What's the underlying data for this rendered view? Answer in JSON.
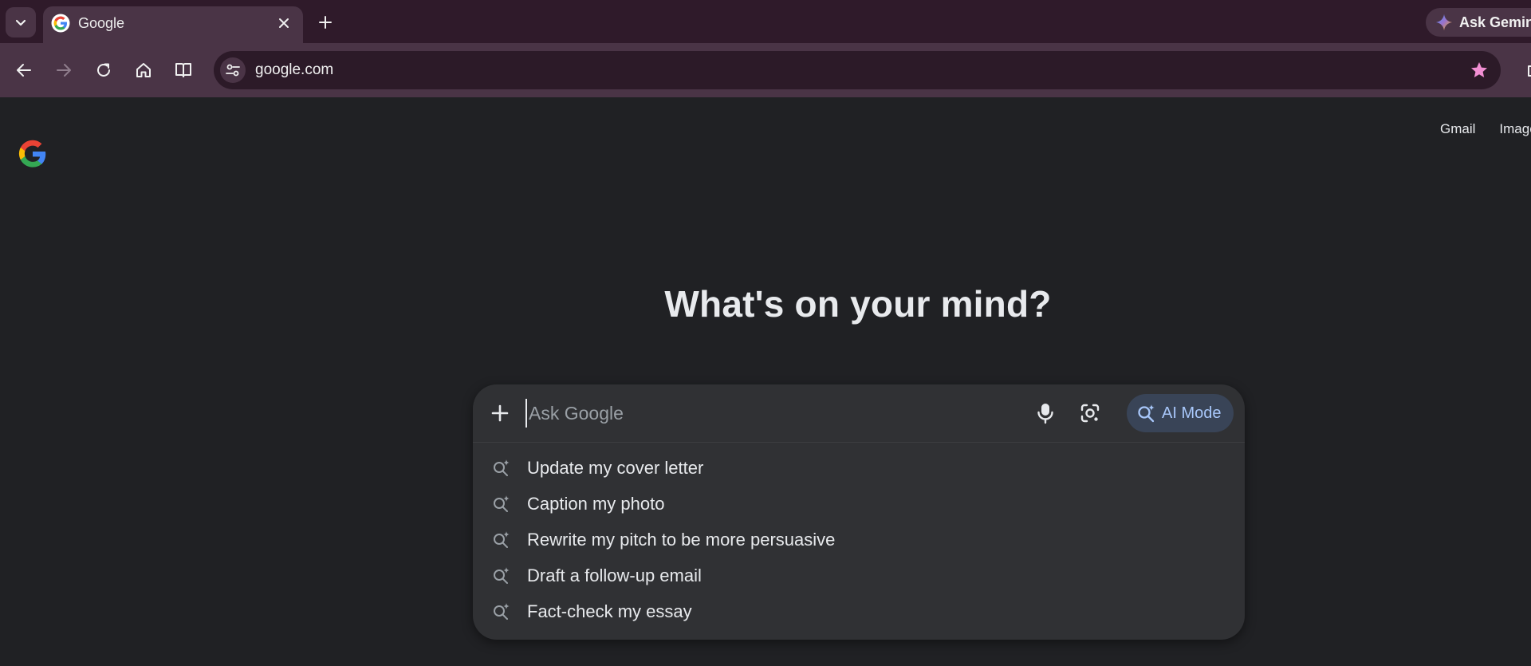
{
  "browser": {
    "tab": {
      "title": "Google"
    },
    "gemini_button": {
      "label": "Ask Gemini"
    },
    "omnibox": {
      "url": "google.com"
    }
  },
  "page": {
    "top_links": [
      "Gmail",
      "Images"
    ],
    "headline": "What's on your mind?",
    "search": {
      "placeholder": "Ask Google",
      "ai_mode_label": "AI Mode"
    },
    "suggestions": [
      "Update my cover letter",
      "Caption my photo",
      "Rewrite my pitch to be more persuasive",
      "Draft a follow-up email",
      "Fact-check my essay"
    ]
  },
  "colors": {
    "tabstrip": "#2f1a2a",
    "toolbar": "#4a3446",
    "page_bg": "#202124",
    "panel_bg": "#303134",
    "ai_mode_text": "#a8c7fa",
    "bookmark_star": "#f28fd3"
  }
}
